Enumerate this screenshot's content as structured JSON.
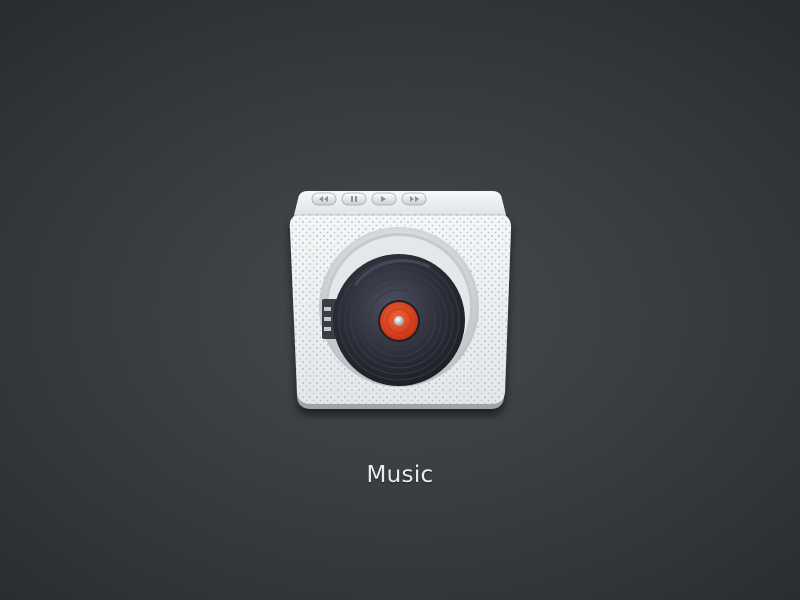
{
  "app": {
    "label": "Music",
    "icon": "music-player-icon"
  },
  "controls": [
    {
      "name": "rewind-button",
      "icon": "rewind-icon"
    },
    {
      "name": "pause-button",
      "icon": "pause-icon"
    },
    {
      "name": "play-button",
      "icon": "play-icon"
    },
    {
      "name": "fast-forward-button",
      "icon": "fast-forward-icon"
    }
  ],
  "colors": {
    "background": "#3a3e42",
    "body": "#eceeef",
    "record": "#2e2f3a",
    "record_label": "#e2461d",
    "label_text": "#e9ebed"
  }
}
